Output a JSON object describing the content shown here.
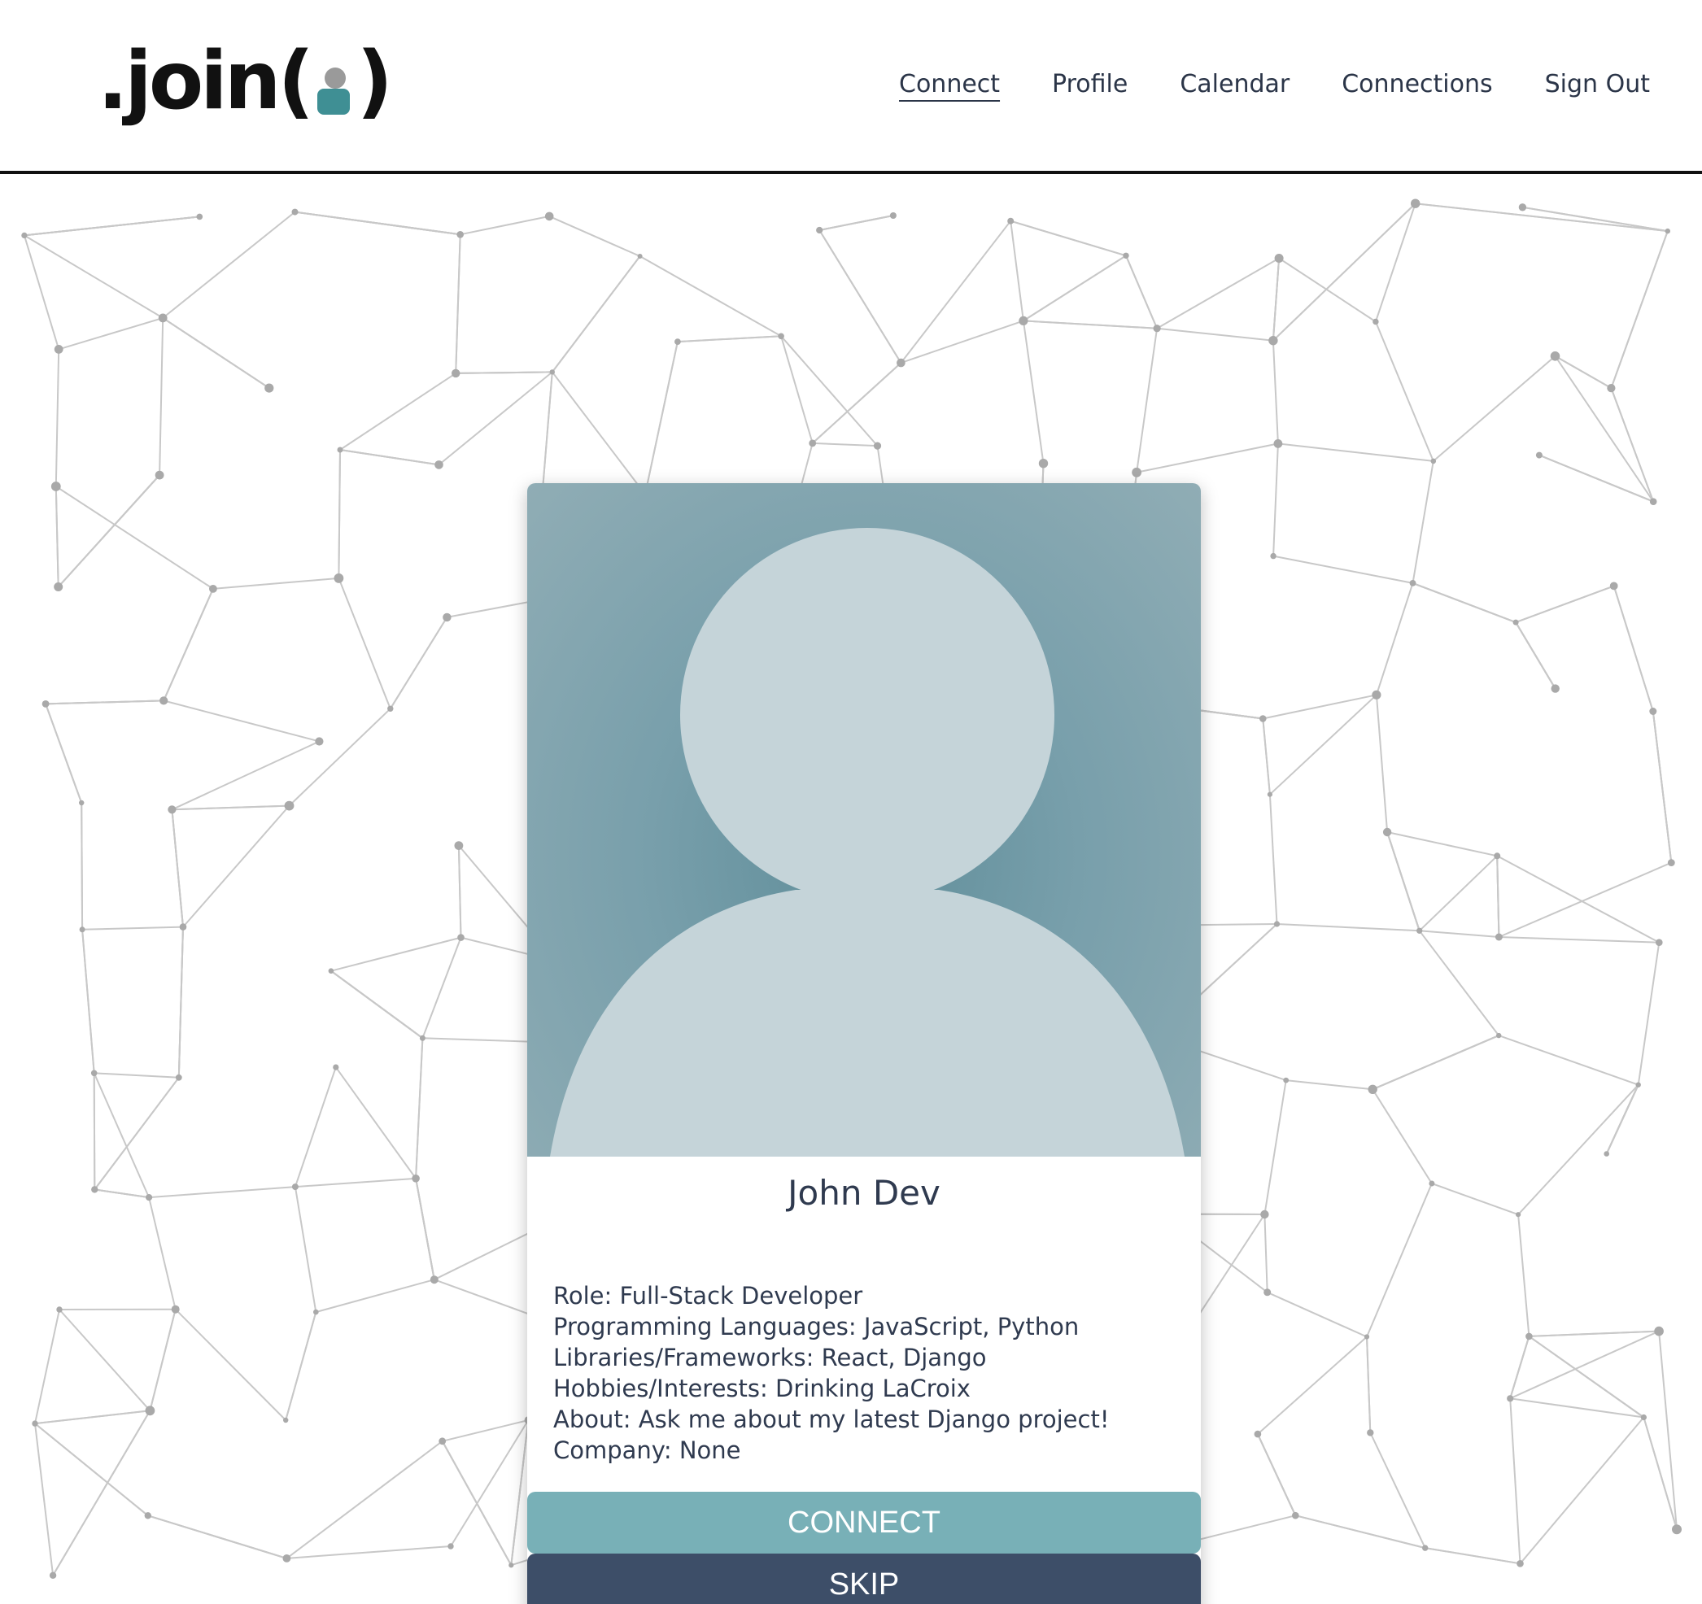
{
  "header": {
    "logo_text_left": ".join(",
    "logo_text_right": ")",
    "nav": [
      {
        "label": "Connect",
        "active": true
      },
      {
        "label": "Profile",
        "active": false
      },
      {
        "label": "Calendar",
        "active": false
      },
      {
        "label": "Connections",
        "active": false
      },
      {
        "label": "Sign Out",
        "active": false
      }
    ]
  },
  "profile": {
    "name": "John Dev",
    "details": [
      "Role: Full-Stack Developer",
      "Programming Languages: JavaScript, Python",
      "Libraries/Frameworks: React, Django",
      "Hobbies/Interests: Drinking LaCroix",
      "About: Ask me about my latest Django project!",
      "Company: None"
    ]
  },
  "actions": {
    "connect_label": "CONNECT",
    "skip_label": "SKIP"
  },
  "colors": {
    "connect_button": "#78b0b7",
    "skip_button": "#3d4e68",
    "avatar_background": "#789fab",
    "avatar_silhouette": "#c5d4d9",
    "text": "#2f3a4f"
  },
  "icons": {
    "logo_person": "person-icon",
    "avatar_placeholder": "user-silhouette-icon",
    "background_pattern": "network-pattern"
  }
}
